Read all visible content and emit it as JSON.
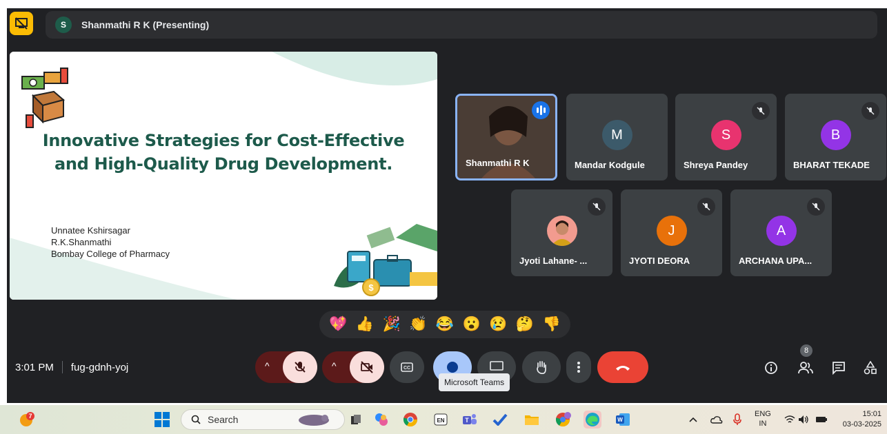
{
  "presenter_bar": {
    "avatar_letter": "S",
    "text": "Shanmathi R K (Presenting)"
  },
  "slide": {
    "title_line1": "Innovative Strategies for Cost-Effective",
    "title_line2": "and High-Quality Drug Development.",
    "author1": "Unnatee Kshirsagar",
    "author2": "R.K.Shanmathi",
    "author3": "Bombay College of Pharmacy"
  },
  "participants": [
    {
      "name": "Shanmathi R K",
      "speaking": true
    },
    {
      "name": "Mandar Kodgule",
      "letter": "M",
      "color": "#3c5a6a"
    },
    {
      "name": "Shreya Pandey",
      "letter": "S",
      "color": "#e8336f",
      "muted": true
    },
    {
      "name": "BHARAT TEKADE",
      "letter": "B",
      "color": "#9334e6",
      "muted": true
    },
    {
      "name": "Jyoti Lahane- ...",
      "muted": true
    },
    {
      "name": "JYOTI DEORA",
      "letter": "J",
      "color": "#e8710a",
      "muted": true
    },
    {
      "name": "ARCHANA UPA...",
      "letter": "A",
      "color": "#9334e6",
      "muted": true
    }
  ],
  "reactions": [
    "💖",
    "👍",
    "🎉",
    "👏",
    "😂",
    "😮",
    "😢",
    "🤔",
    "👎"
  ],
  "meeting": {
    "time": "3:01 PM",
    "code": "fug-gdnh-yoj",
    "people_count": "8"
  },
  "tooltip": "Microsoft Teams",
  "taskbar": {
    "search_placeholder": "Search",
    "lang_line1": "ENG",
    "lang_line2": "IN",
    "time": "15:01",
    "date": "03-03-2025",
    "weather_badge": "7"
  },
  "colors": {
    "meet_bg": "#202124",
    "tile_bg": "#3c4043",
    "end_call": "#ea4335",
    "slide_title": "#1d5a4b"
  }
}
